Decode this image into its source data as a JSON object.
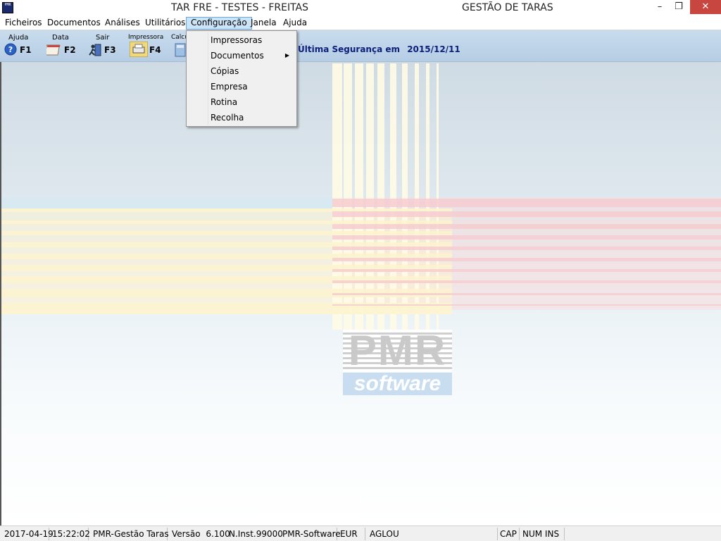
{
  "app": {
    "title": "TAR FRE - TESTES - FREITAS",
    "module": "GESTÃO DE TARAS",
    "icon_text": "PMR"
  },
  "window_controls": {
    "minimize": "–",
    "maximize": "❐",
    "close": "✕"
  },
  "menubar": {
    "items": [
      "Ficheiros",
      "Documentos",
      "Análises",
      "Utilitários",
      "Configuração",
      "Janela",
      "Ajuda"
    ],
    "active": "Configuração"
  },
  "toolbar": {
    "buttons": [
      {
        "caption": "Ajuda",
        "key": "F1",
        "icon": "help-icon"
      },
      {
        "caption": "Data",
        "key": "F2",
        "icon": "calendar-icon"
      },
      {
        "caption": "Sair",
        "key": "F3",
        "icon": "exit-icon"
      },
      {
        "caption": "Impressora",
        "key": "F4",
        "icon": "printer-icon"
      },
      {
        "caption": "Calcu",
        "key": "",
        "icon": "calculator-icon"
      }
    ],
    "backup_label": "Última Segurança em",
    "backup_date": "2015/12/11"
  },
  "dropdown": {
    "items": [
      {
        "label": "Impressoras",
        "submenu": false
      },
      {
        "label": "Documentos",
        "submenu": true
      },
      {
        "label": "Cópias",
        "submenu": false
      },
      {
        "label": "Empresa",
        "submenu": false
      },
      {
        "label": "Rotina",
        "submenu": false
      },
      {
        "label": "Recolha",
        "submenu": false
      }
    ]
  },
  "logo": {
    "brand": "PMR",
    "tagline": "software"
  },
  "statusbar": {
    "date": "2017-04-19",
    "time": "15:22:02",
    "product": "PMR-Gestão Taras",
    "version_label": "Versão",
    "version": "6.100",
    "install": "N.Inst.99000",
    "vendor": "PMR-Software",
    "currency": "EUR",
    "user": "AGLOU",
    "cap": "CAP",
    "num_ins": "NUM INS"
  },
  "colors": {
    "toolbar_bg": "#c3d7ea",
    "backup_text": "#0d1f7a",
    "menu_active_bg": "#cce4f7",
    "close_button": "#c7463f"
  }
}
